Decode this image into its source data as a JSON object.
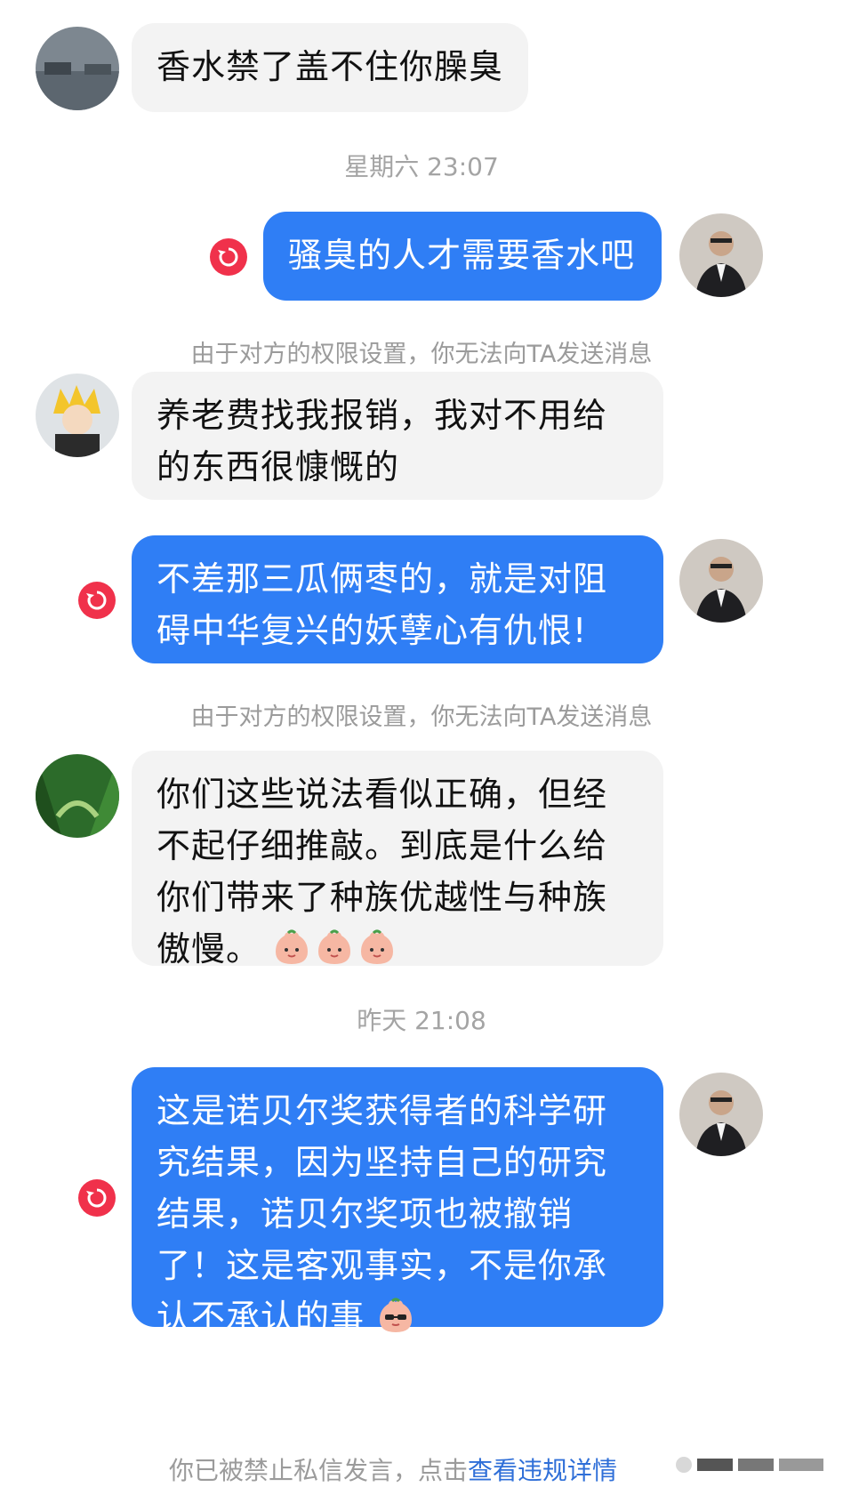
{
  "messages": [
    {
      "text": "香水禁了盖不住你臊臭"
    },
    {
      "text": "骚臭的人才需要香水吧"
    },
    {
      "text": "养老费找我报销，我对不用给的东西很慷慨的"
    },
    {
      "text": "不差那三瓜俩枣的，就是对阻碍中华复兴的妖孽心有仇恨!"
    },
    {
      "text": "你们这些说法看似正确，但经不起仔细推敲。到底是什么给你们带来了种族优越性与种族傲慢。"
    },
    {
      "text": "这是诺贝尔奖获得者的科学研究结果，因为坚持自己的研究结果，诺贝尔奖项也被撤销了！这是客观事实，不是你承认不承认的事"
    }
  ],
  "timestamps": [
    "星期六 23:07",
    "昨天 21:08"
  ],
  "notices": [
    "由于对方的权限设置，你无法向TA发送消息",
    "由于对方的权限设置，你无法向TA发送消息"
  ],
  "footer": {
    "text": "你已被禁止私信发言，点击",
    "link": "查看违规详情"
  },
  "icons": {
    "resend": "resend-icon",
    "emoji": "peach-face-emoji",
    "emoji_sunglasses": "peach-sunglasses-emoji"
  },
  "colors": {
    "outgoing_bubble": "#2f7ef5",
    "incoming_bubble": "#f3f3f3",
    "resend": "#f0314b",
    "link": "#2f6fd8"
  }
}
